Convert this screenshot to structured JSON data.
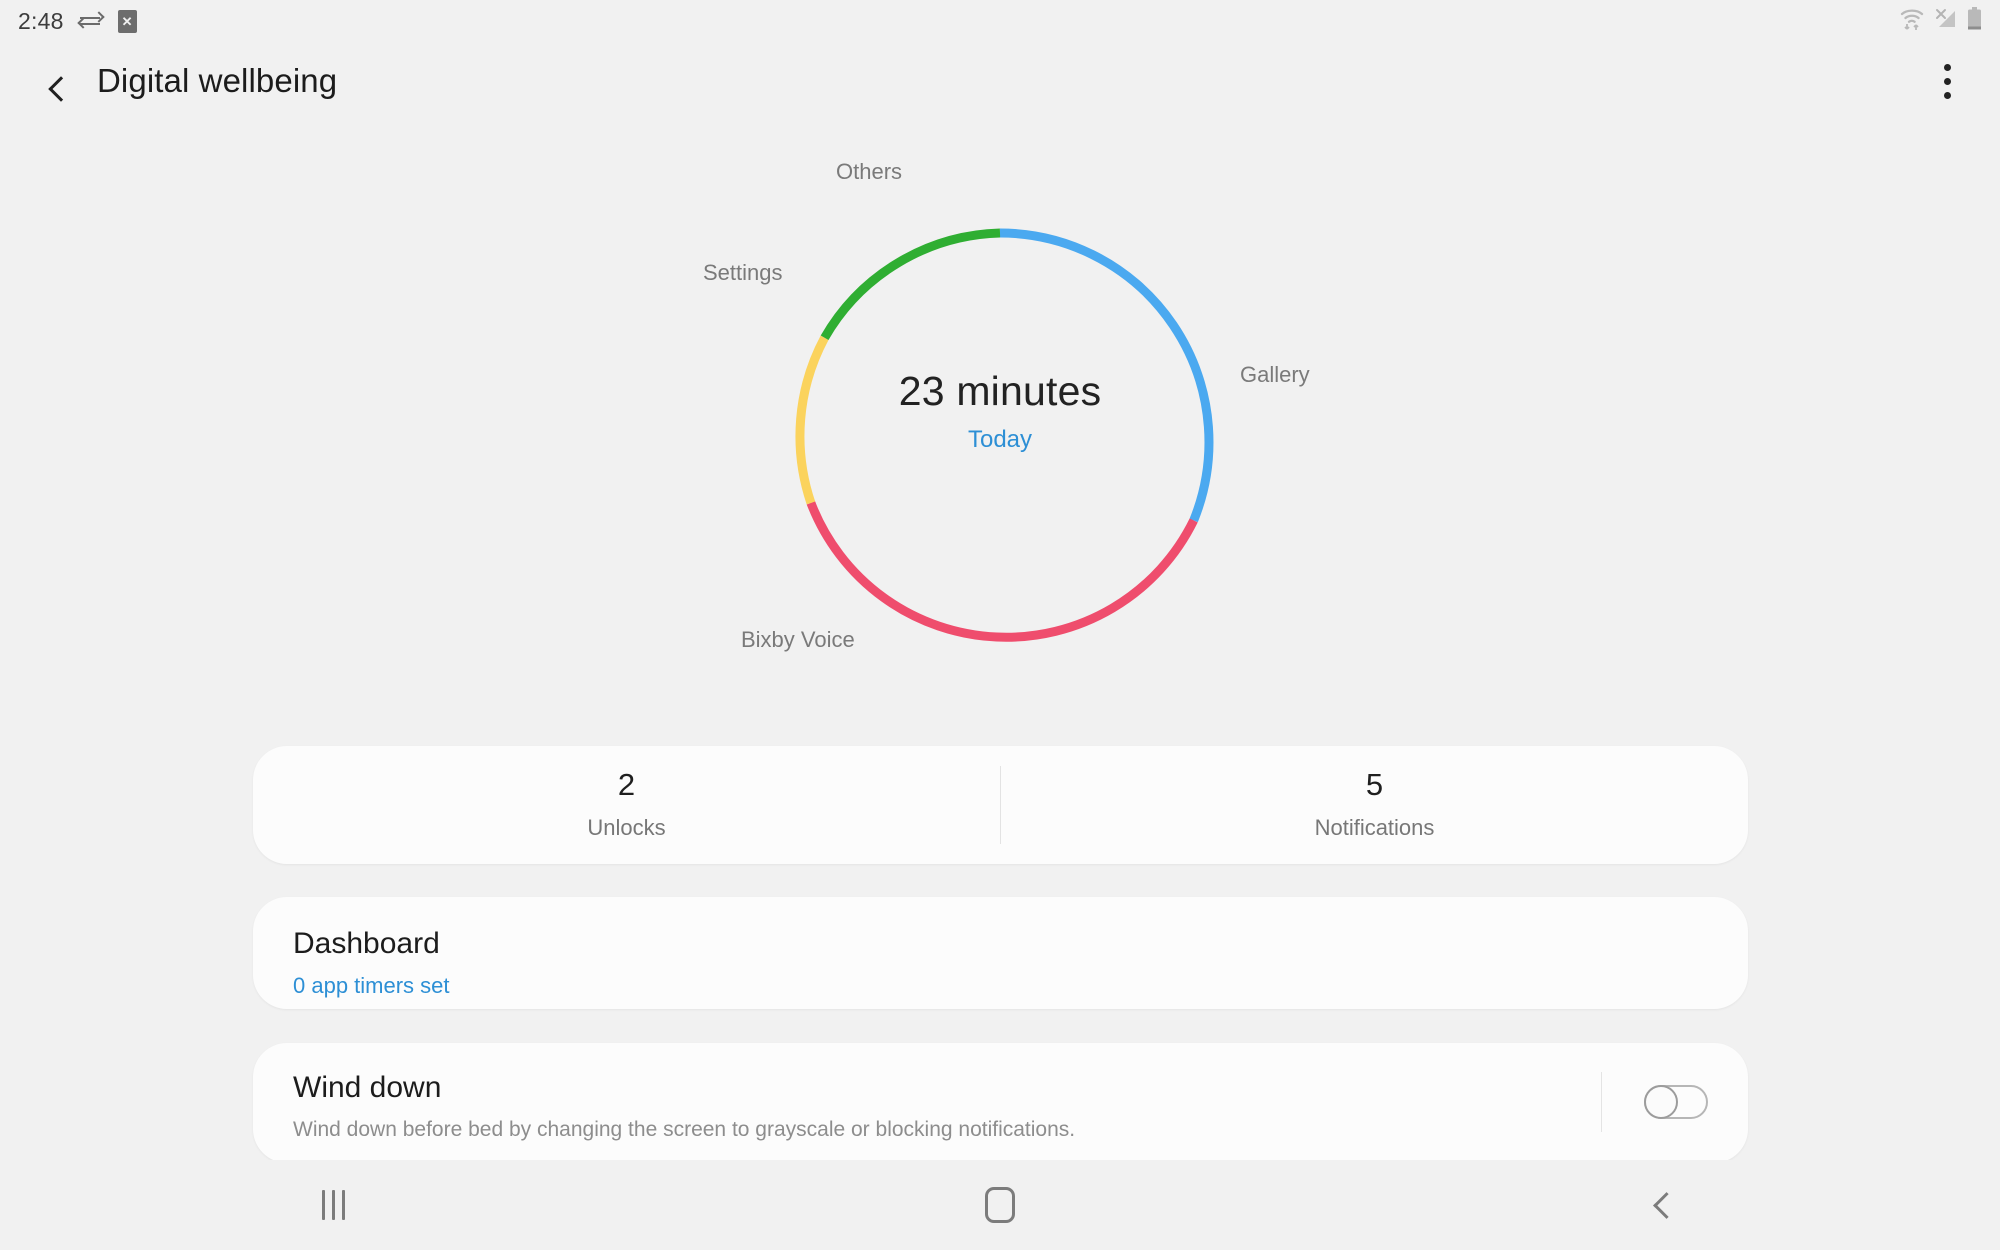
{
  "statusbar": {
    "clock": "2:48",
    "icons": [
      "data-transfer-icon",
      "file-blocked-icon"
    ],
    "right_icons": [
      "wifi-icon",
      "no-signal-icon",
      "battery-icon"
    ]
  },
  "header": {
    "title": "Digital wellbeing",
    "back_icon": "back-chevron-icon",
    "menu_icon": "more-options-icon"
  },
  "chart_data": {
    "type": "pie",
    "title": "23 minutes",
    "subtitle": "Today",
    "categories": [
      "Gallery",
      "Bixby Voice",
      "Settings",
      "Others"
    ],
    "values": [
      8,
      8,
      4.3,
      3.7
    ],
    "unit": "minutes",
    "total": 23,
    "colors": [
      "#4ba9f0",
      "#ef4d6d",
      "#fbd35d",
      "#2fae32"
    ],
    "start_angles_deg": [
      0,
      112,
      236,
      303
    ],
    "end_angles_deg": [
      112,
      236,
      303,
      360
    ],
    "legend": "labels-around-ring",
    "grid": false
  },
  "stats": {
    "items": [
      {
        "value": "2",
        "label": "Unlocks"
      },
      {
        "value": "5",
        "label": "Notifications"
      }
    ]
  },
  "dashboard": {
    "title": "Dashboard",
    "subtitle": "0 app timers set"
  },
  "wind_down": {
    "title": "Wind down",
    "description": "Wind down before bed by changing the screen to grayscale or blocking notifications.",
    "toggle_state": "off"
  },
  "navbar": {
    "recents": "recents-icon",
    "home": "home-icon",
    "back": "back-icon"
  },
  "colors": {
    "background": "#f1f1f1",
    "card": "#fcfcfc",
    "accent_blue": "#2d8fd5",
    "text_primary": "#1c1c1c",
    "text_secondary": "#7a7a7a"
  }
}
